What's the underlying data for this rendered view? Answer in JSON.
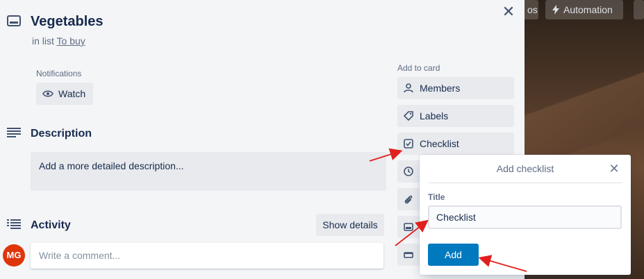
{
  "board": {
    "buttons": [
      {
        "label": "os"
      },
      {
        "label": "Automation",
        "icon": "bolt-icon"
      }
    ]
  },
  "card": {
    "title": "Vegetables",
    "in_list_prefix": "in list",
    "list_name": "To buy",
    "icon": "card-icon"
  },
  "notifications": {
    "label": "Notifications",
    "watch_label": "Watch",
    "watch_icon": "eye-icon"
  },
  "description": {
    "heading": "Description",
    "placeholder": "Add a more detailed description..."
  },
  "activity": {
    "heading": "Activity",
    "show_details_label": "Show details",
    "avatar_initials": "MG",
    "avatar_color": "#de350b",
    "comment_placeholder": "Write a comment..."
  },
  "add_to_card": {
    "label": "Add to card",
    "items": [
      {
        "label": "Members",
        "icon": "person-icon"
      },
      {
        "label": "Labels",
        "icon": "tag-icon"
      },
      {
        "label": "Checklist",
        "icon": "checkbox-icon"
      },
      {
        "label": "",
        "icon": "clock-icon"
      },
      {
        "label": "",
        "icon": "paperclip-icon"
      },
      {
        "label": "",
        "icon": "card-icon"
      },
      {
        "label": "",
        "icon": "archive-icon"
      }
    ]
  },
  "popover": {
    "title": "Add checklist",
    "field_label": "Title",
    "input_value": "Checklist",
    "add_label": "Add"
  },
  "colors": {
    "primary": "#0079bf",
    "annotation_arrow": "#e0201e",
    "modal_bg": "#f4f5f7"
  }
}
